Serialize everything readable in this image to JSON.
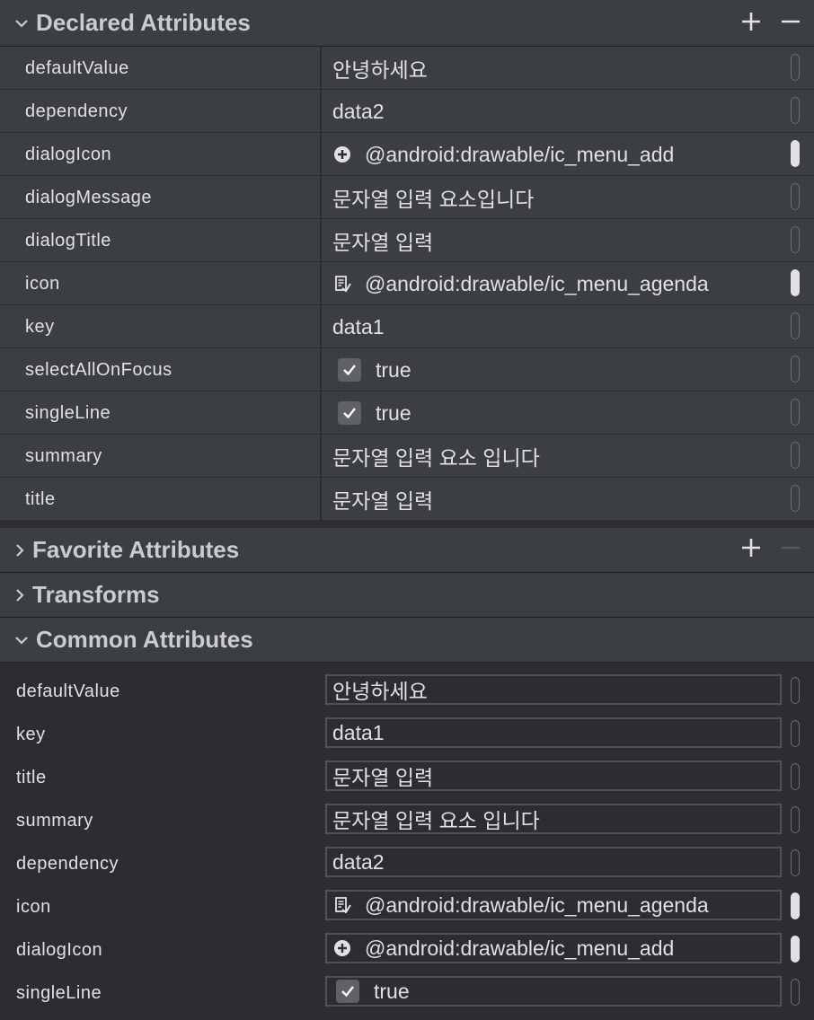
{
  "sections": {
    "declared": {
      "title": "Declared Attributes",
      "expanded": true
    },
    "favorite": {
      "title": "Favorite Attributes",
      "expanded": false
    },
    "transforms": {
      "title": "Transforms",
      "expanded": false
    },
    "common": {
      "title": "Common Attributes",
      "expanded": true
    }
  },
  "declared_rows": [
    {
      "name": "defaultValue",
      "value": "안녕하세요",
      "icon": "",
      "indicator": "empty"
    },
    {
      "name": "dependency",
      "value": "data2",
      "icon": "",
      "indicator": "empty"
    },
    {
      "name": "dialogIcon",
      "value": "@android:drawable/ic_menu_add",
      "icon": "add-circle-icon",
      "indicator": "filled"
    },
    {
      "name": "dialogMessage",
      "value": "문자열 입력 요소입니다",
      "icon": "",
      "indicator": "empty"
    },
    {
      "name": "dialogTitle",
      "value": "문자열 입력",
      "icon": "",
      "indicator": "empty"
    },
    {
      "name": "icon",
      "value": "@android:drawable/ic_menu_agenda",
      "icon": "agenda-icon",
      "indicator": "filled"
    },
    {
      "name": "key",
      "value": "data1",
      "icon": "",
      "indicator": "empty"
    },
    {
      "name": "selectAllOnFocus",
      "value": "true",
      "icon": "checkbox-checked-icon",
      "indicator": "empty"
    },
    {
      "name": "singleLine",
      "value": "true",
      "icon": "checkbox-checked-icon",
      "indicator": "empty"
    },
    {
      "name": "summary",
      "value": "문자열 입력 요소 입니다",
      "icon": "",
      "indicator": "empty"
    },
    {
      "name": "title",
      "value": "문자열 입력",
      "icon": "",
      "indicator": "empty"
    }
  ],
  "common_rows": [
    {
      "name": "defaultValue",
      "value": "안녕하세요",
      "icon": "",
      "indicator": "empty"
    },
    {
      "name": "key",
      "value": "data1",
      "icon": "",
      "indicator": "empty"
    },
    {
      "name": "title",
      "value": "문자열 입력",
      "icon": "",
      "indicator": "empty"
    },
    {
      "name": "summary",
      "value": "문자열 입력 요소 입니다",
      "icon": "",
      "indicator": "empty"
    },
    {
      "name": "dependency",
      "value": "data2",
      "icon": "",
      "indicator": "empty"
    },
    {
      "name": "icon",
      "value": "@android:drawable/ic_menu_agenda",
      "icon": "agenda-icon",
      "indicator": "filled"
    },
    {
      "name": "dialogIcon",
      "value": "@android:drawable/ic_menu_add",
      "icon": "add-circle-icon",
      "indicator": "filled"
    },
    {
      "name": "singleLine",
      "value": "true",
      "icon": "checkbox-checked-icon",
      "indicator": "empty"
    }
  ]
}
